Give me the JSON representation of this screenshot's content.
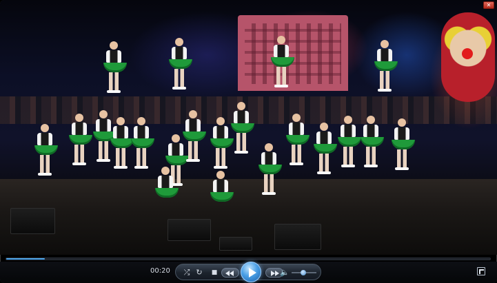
{
  "window": {
    "close_icon": "close-icon"
  },
  "player": {
    "current_time": "00:20",
    "progress_fraction": 0.08,
    "volume_fraction": 0.35
  },
  "controls": {
    "shuffle_icon": "shuffle-icon",
    "repeat_icon": "repeat-icon",
    "stop_icon": "stop-icon",
    "previous_icon": "previous-icon",
    "play_icon": "play-icon",
    "next_icon": "next-icon",
    "mute_icon": "speaker-icon",
    "fullscreen_icon": "fullscreen-icon"
  },
  "colors": {
    "accent": "#1f7fd1",
    "costume_green": "#1f9a3a"
  }
}
